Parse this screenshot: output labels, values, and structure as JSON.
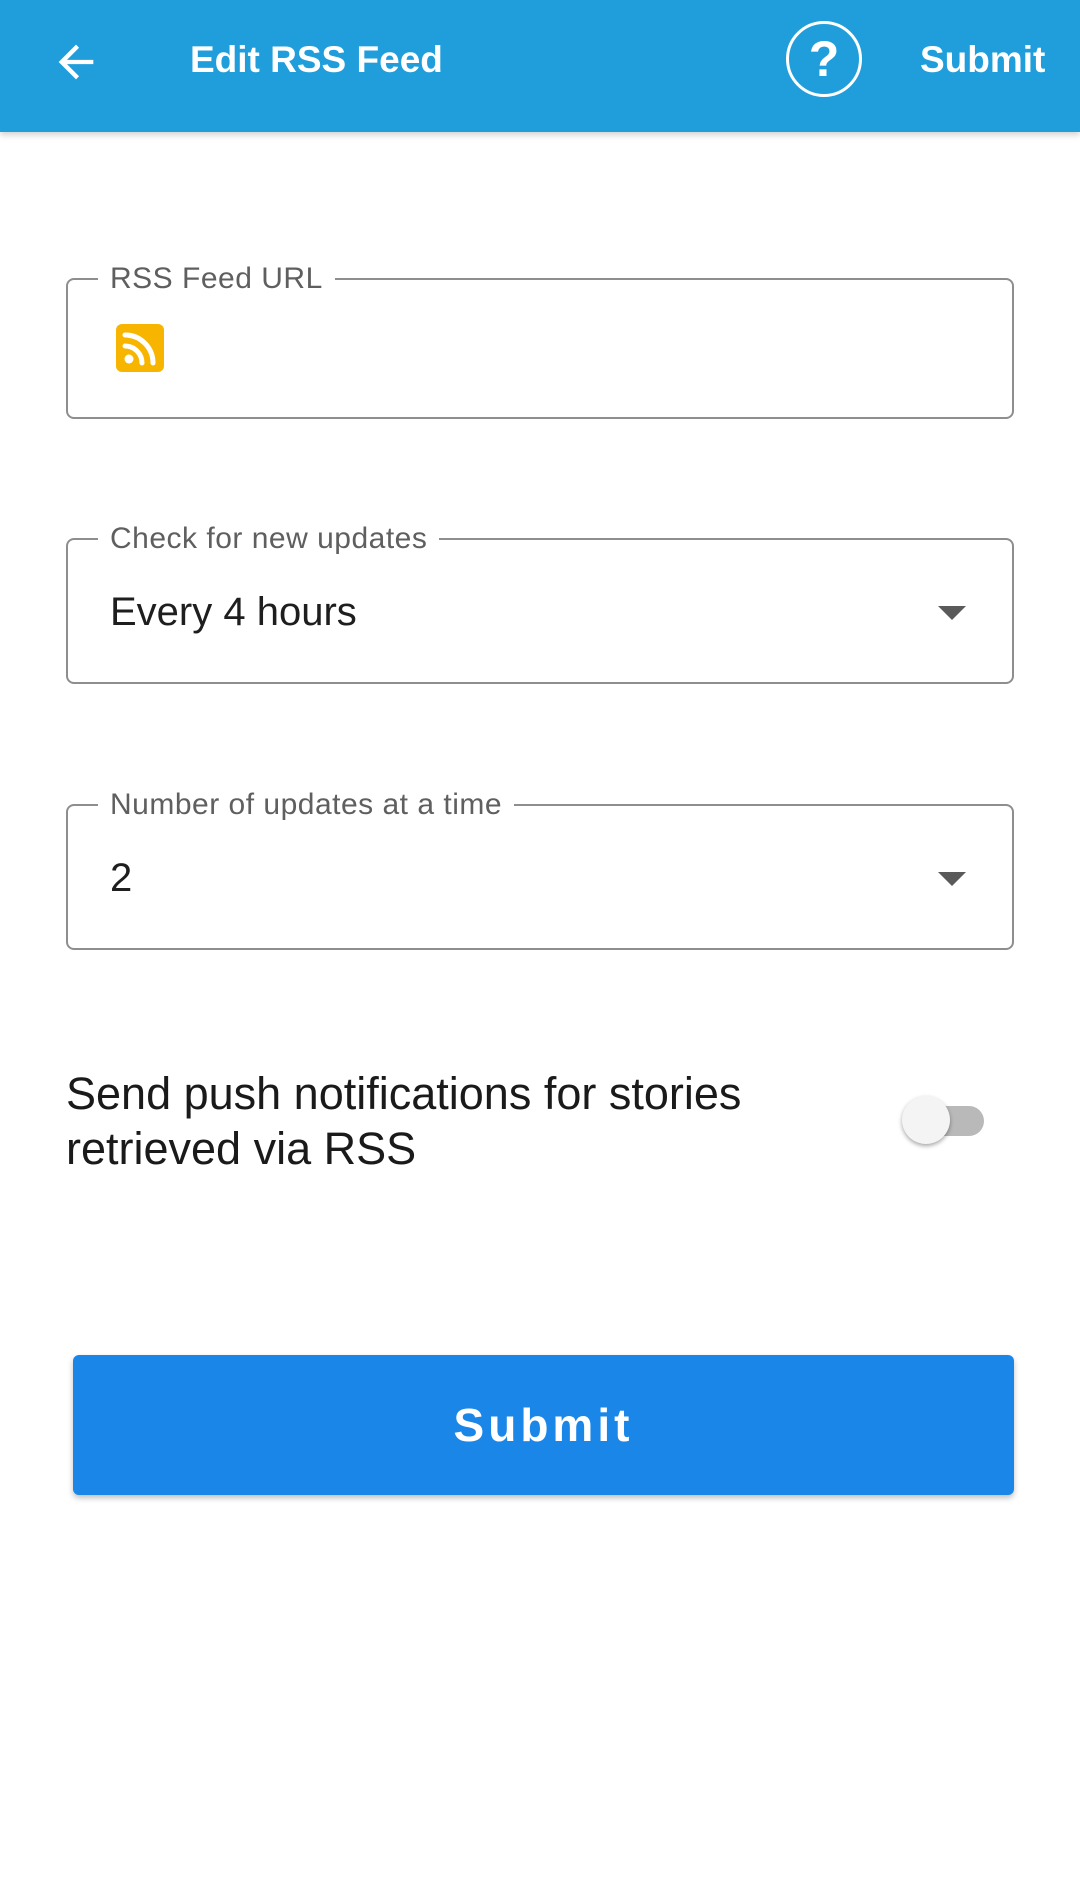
{
  "appbar": {
    "title": "Edit RSS Feed",
    "submit_label": "Submit",
    "help_symbol": "?",
    "background_color": "#1f9edb",
    "back_icon": "arrow-left-icon",
    "help_icon": "help-circle-icon"
  },
  "form": {
    "rss_url": {
      "label": "RSS Feed URL",
      "value": "",
      "icon": "rss-icon",
      "icon_color": "#f7b500"
    },
    "check_updates": {
      "label": "Check for new updates",
      "selected": "Every 4 hours"
    },
    "num_updates": {
      "label": "Number of updates at a time",
      "selected": "2"
    },
    "push_notifications": {
      "label": "Send push notifications for stories retrieved via RSS",
      "enabled": false
    }
  },
  "submit_button": {
    "label": "Submit",
    "color": "#1a87e8"
  }
}
